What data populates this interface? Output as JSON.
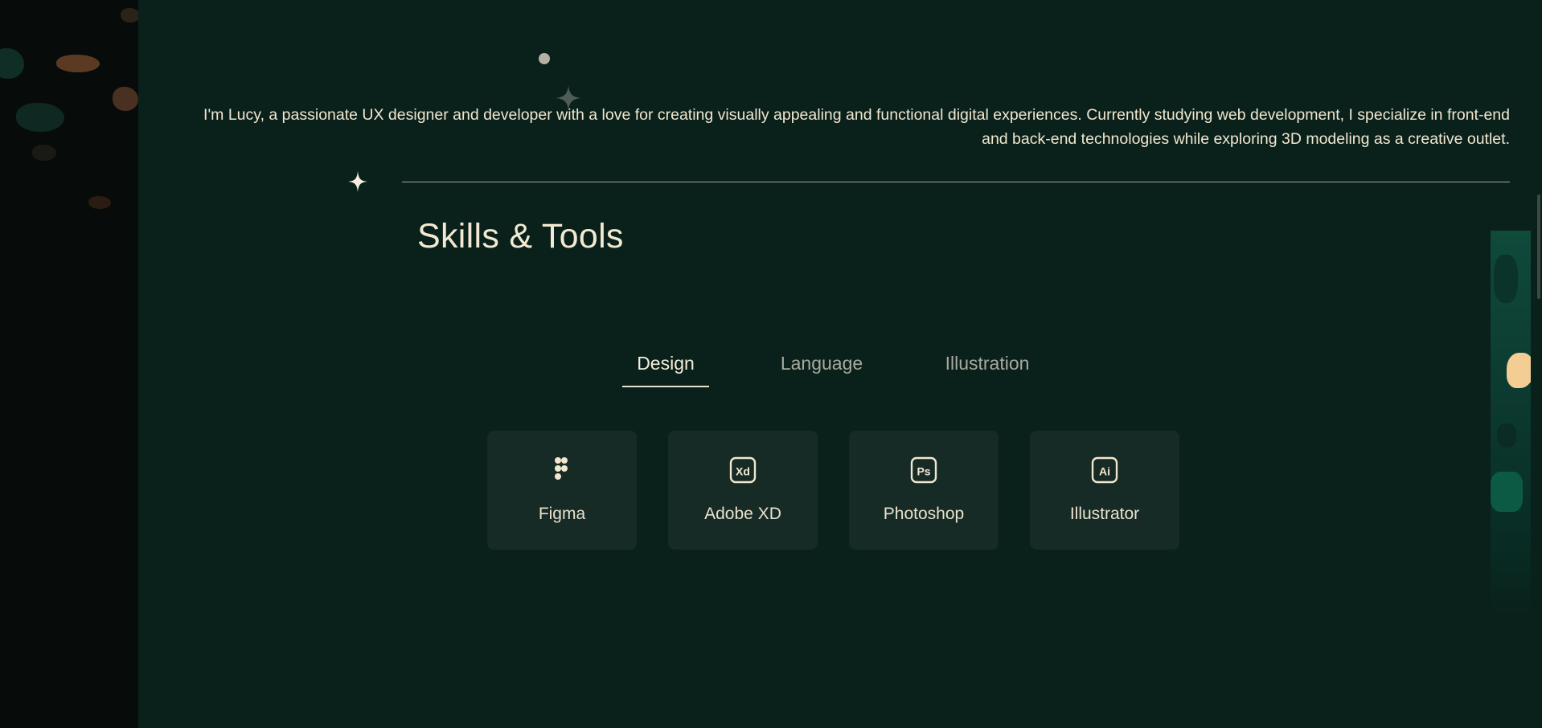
{
  "intro": {
    "line1": "I'm Lucy, a passionate UX designer and developer with a love for creating visually appealing and functional digital experiences. Currently studying web development, I specialize in front-end",
    "line2": "and back-end technologies while exploring 3D modeling as a creative outlet."
  },
  "skills": {
    "title": "Skills & Tools",
    "tabs": [
      {
        "label": "Design",
        "active": true
      },
      {
        "label": "Language",
        "active": false
      },
      {
        "label": "Illustration",
        "active": false
      }
    ],
    "cards": [
      {
        "label": "Figma",
        "icon": "figma-icon"
      },
      {
        "label": "Adobe XD",
        "icon": "adobe-xd-icon"
      },
      {
        "label": "Photoshop",
        "icon": "photoshop-icon"
      },
      {
        "label": "Illustrator",
        "icon": "illustrator-icon"
      }
    ]
  },
  "colors": {
    "background": "#0a201b",
    "card": "#162a26",
    "text": "#f1e7cf",
    "muted_tab": "#a8aaa0"
  }
}
